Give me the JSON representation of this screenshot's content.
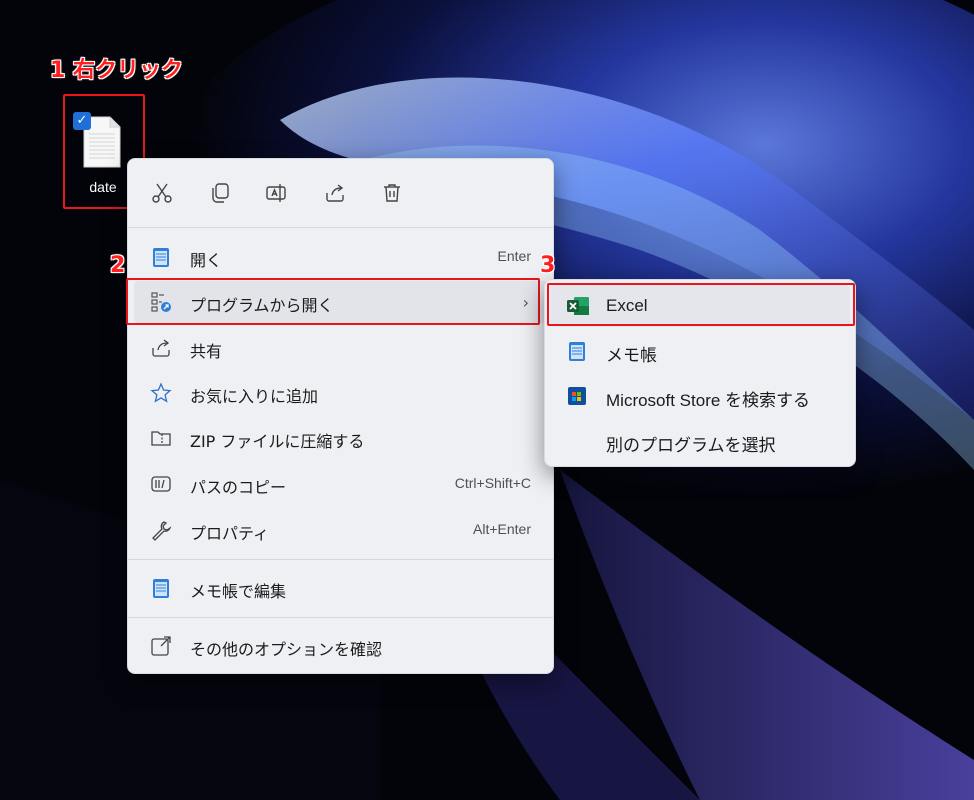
{
  "annotations": {
    "step1": "1 右クリック",
    "step2": "2",
    "step3": "3"
  },
  "desktop": {
    "file_label": "date"
  },
  "quick_actions": [
    "cut-icon",
    "copy-icon",
    "rename-icon",
    "share-icon",
    "delete-icon"
  ],
  "context_menu": {
    "items": [
      {
        "label": "開く",
        "shortcut": "Enter",
        "icon": "notepad-icon"
      },
      {
        "label": "プログラムから開く",
        "shortcut": "",
        "icon": "open-with-icon"
      },
      {
        "label": "共有",
        "shortcut": "",
        "icon": "share-icon"
      },
      {
        "label": "お気に入りに追加",
        "shortcut": "",
        "icon": "star-icon"
      },
      {
        "label": "ZIP ファイルに圧縮する",
        "shortcut": "",
        "icon": "zip-folder-icon"
      },
      {
        "label": "パスのコピー",
        "shortcut": "Ctrl+Shift+C",
        "icon": "path-copy-icon"
      },
      {
        "label": "プロパティ",
        "shortcut": "Alt+Enter",
        "icon": "wrench-icon"
      },
      {
        "label": "メモ帳で編集",
        "shortcut": "",
        "icon": "notepad-icon"
      },
      {
        "label": "その他のオプションを確認",
        "shortcut": "",
        "icon": "more-options-icon"
      }
    ]
  },
  "submenu": {
    "items": [
      {
        "label": "Excel",
        "icon": "excel-icon"
      },
      {
        "label": "メモ帳",
        "icon": "notepad-icon"
      },
      {
        "label": "Microsoft Store を検索する",
        "icon": "store-icon"
      },
      {
        "label": "別のプログラムを選択",
        "icon": ""
      }
    ]
  },
  "colors": {
    "annotation_red": "#e8151b",
    "menu_bg": "#eef0f4",
    "accent_blue": "#1f6fd6"
  }
}
